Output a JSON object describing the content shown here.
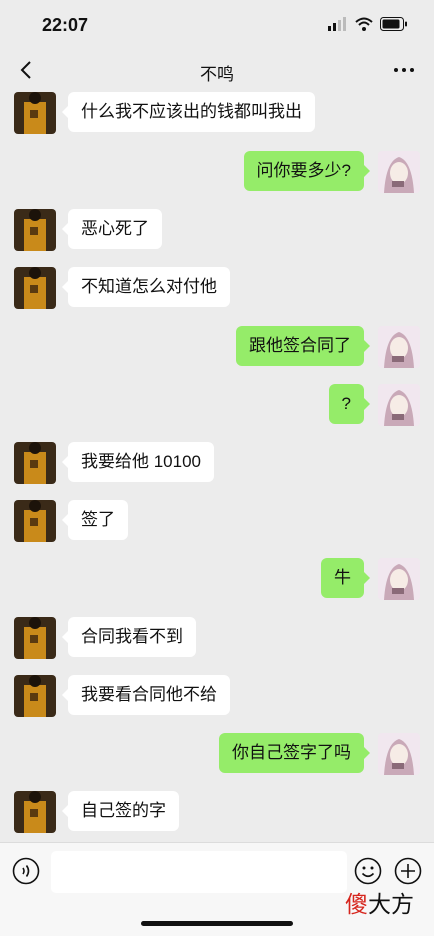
{
  "status_bar": {
    "time": "22:07"
  },
  "header": {
    "title": "不鸣"
  },
  "messages": [
    {
      "side": "in",
      "text": "什么我不应该出的钱都叫我出"
    },
    {
      "side": "out",
      "text": "问你要多少?"
    },
    {
      "side": "in",
      "text": "恶心死了"
    },
    {
      "side": "in",
      "text": "不知道怎么对付他"
    },
    {
      "side": "out",
      "text": "跟他签合同了"
    },
    {
      "side": "out",
      "text": "?"
    },
    {
      "side": "in",
      "text": "我要给他 10100"
    },
    {
      "side": "in",
      "text": "签了"
    },
    {
      "side": "out",
      "text": "牛"
    },
    {
      "side": "in",
      "text": "合同我看不到"
    },
    {
      "side": "in",
      "text": "我要看合同他不给"
    },
    {
      "side": "out",
      "text": "你自己签字了吗"
    },
    {
      "side": "in",
      "text": "自己签的字"
    }
  ],
  "input_bar": {
    "voice_icon": "voice-icon",
    "emoji_icon": "emoji-icon",
    "plus_icon": "plus-icon"
  },
  "watermark": {
    "part1": "傻",
    "part2": "大方"
  },
  "colors": {
    "background": "#ececec",
    "outgoing_bubble": "#95ec69",
    "incoming_bubble": "#ffffff"
  }
}
